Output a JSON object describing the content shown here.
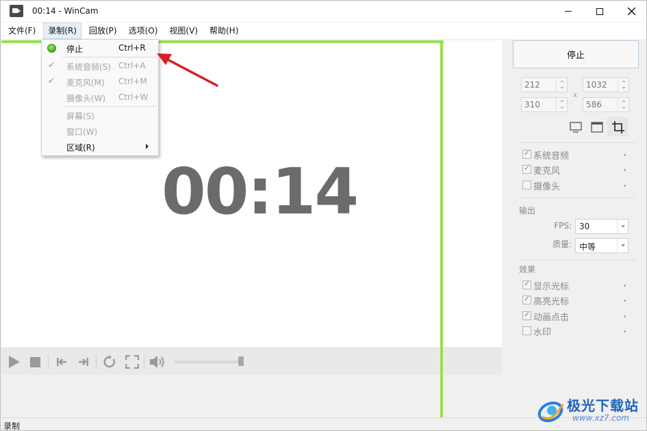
{
  "window": {
    "title": "00:14 - WinCam",
    "icon": "camera-icon"
  },
  "menubar": {
    "items": [
      "文件(F)",
      "录制(R)",
      "回放(P)",
      "选项(O)",
      "视图(V)",
      "帮助(H)"
    ],
    "active": "录制(R)"
  },
  "record_menu": {
    "items": [
      {
        "label": "停止",
        "shortcut": "Ctrl+R",
        "state": "enabled",
        "icon": "green-dot-icon"
      },
      {
        "label": "系统音频(S)",
        "shortcut": "Ctrl+A",
        "state": "disabled",
        "checked": true
      },
      {
        "label": "麦克风(M)",
        "shortcut": "Ctrl+M",
        "state": "disabled",
        "checked": true
      },
      {
        "label": "摄像头(W)",
        "shortcut": "Ctrl+W",
        "state": "disabled",
        "checked": false
      },
      {
        "label": "屏幕(S)",
        "shortcut": "",
        "state": "disabled"
      },
      {
        "label": "窗口(W)",
        "shortcut": "",
        "state": "disabled"
      },
      {
        "label": "区域(R)",
        "shortcut": "",
        "state": "enabled",
        "submenu": true
      }
    ]
  },
  "preview": {
    "timer": "00:14",
    "frame_color": "#96e050"
  },
  "playback": {
    "icons": [
      "play-icon",
      "stop-icon",
      "skip-previous-icon",
      "skip-next-icon",
      "refresh-icon",
      "fullscreen-icon",
      "volume-icon"
    ]
  },
  "status": {
    "text": "录制"
  },
  "panel": {
    "stop_button": "停止",
    "region": {
      "x": "212",
      "width": "1032",
      "y": "310",
      "height": "586",
      "separator": "x"
    },
    "capture_options": [
      {
        "label": "系统音频",
        "checked": true
      },
      {
        "label": "麦克风",
        "checked": true
      },
      {
        "label": "摄像头",
        "checked": false
      }
    ],
    "output": {
      "section_label": "输出",
      "fps_label": "FPS:",
      "fps_value": "30",
      "quality_label": "质量:",
      "quality_value": "中等"
    },
    "effects": {
      "section_label": "效果",
      "items": [
        {
          "label": "显示光标",
          "checked": true
        },
        {
          "label": "高亮光标",
          "checked": true
        },
        {
          "label": "动画点击",
          "checked": true
        },
        {
          "label": "水印",
          "checked": false
        }
      ]
    }
  },
  "watermark": {
    "title": "极光下载站",
    "url": "www.xz7.com"
  },
  "colors": {
    "accent_green": "#96e050",
    "annotation_red": "#d62020",
    "watermark_blue": "#1e63b8"
  }
}
